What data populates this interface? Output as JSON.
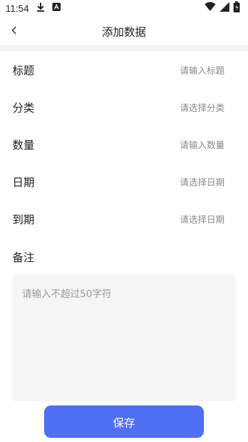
{
  "status_bar": {
    "time": "11:54",
    "icons_left": [
      "download-icon",
      "a-badge-icon"
    ],
    "icons_right": [
      "wifi-icon",
      "signal-icon",
      "battery-icon"
    ]
  },
  "header": {
    "title": "添加数据",
    "back_icon": "chevron-left-icon"
  },
  "form": {
    "rows": [
      {
        "label": "标题",
        "placeholder": "请输入标题"
      },
      {
        "label": "分类",
        "placeholder": "请选择分类"
      },
      {
        "label": "数量",
        "placeholder": "请输入数量"
      },
      {
        "label": "日期",
        "placeholder": "请选择日期"
      },
      {
        "label": "到期",
        "placeholder": "请选择日期"
      }
    ],
    "remark": {
      "label": "备注",
      "placeholder": "请输入不超过50字符"
    }
  },
  "actions": {
    "save_label": "保存"
  },
  "colors": {
    "accent": "#4f6ff5",
    "placeholder": "#8a8a8a",
    "divider": "#f3f3f3",
    "textarea_bg": "#f5f5f5"
  }
}
